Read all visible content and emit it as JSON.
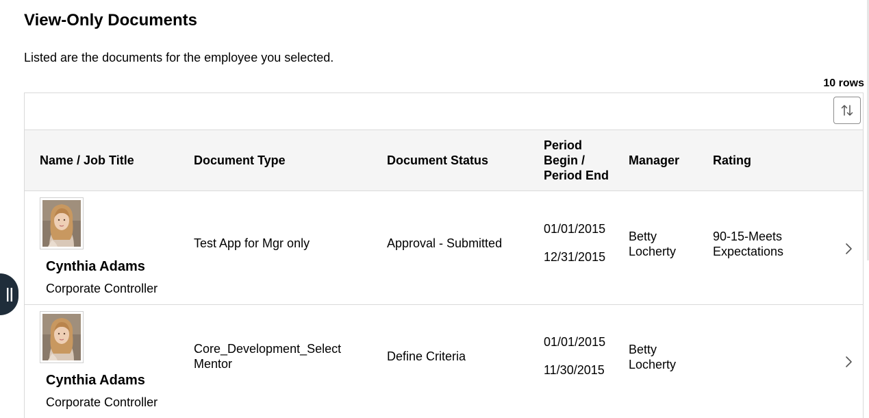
{
  "page": {
    "title": "View-Only Documents",
    "intro": "Listed are the documents for the employee you selected.",
    "row_count": "10 rows"
  },
  "toolbar": {
    "sort_icon": "sort-arrows-icon"
  },
  "columns": {
    "name": "Name / Job Title",
    "doc_type": "Document Type",
    "doc_status": "Document Status",
    "period_line1": "Period",
    "period_line2": "Begin /",
    "period_line3": "Period End",
    "manager": "Manager",
    "rating": "Rating"
  },
  "rows": [
    {
      "name": "Cynthia Adams",
      "job_title": "Corporate Controller",
      "doc_type_line1": "Test App for Mgr only",
      "doc_type_line2": "",
      "doc_status": "Approval - Submitted",
      "period_begin": "01/01/2015",
      "period_end": "12/31/2015",
      "manager_line1": "Betty",
      "manager_line2": "Locherty",
      "rating_line1": "90-15-Meets",
      "rating_line2": "Expectations"
    },
    {
      "name": "Cynthia Adams",
      "job_title": "Corporate Controller",
      "doc_type_line1": "Core_Development_Select",
      "doc_type_line2": "Mentor",
      "doc_status": "Define Criteria",
      "period_begin": "01/01/2015",
      "period_end": "11/30/2015",
      "manager_line1": "Betty",
      "manager_line2": "Locherty",
      "rating_line1": "",
      "rating_line2": ""
    }
  ],
  "colors": {
    "header_bg": "#f5f5f5",
    "border": "#d9d9d9",
    "side_handle": "#1f2d3a"
  }
}
